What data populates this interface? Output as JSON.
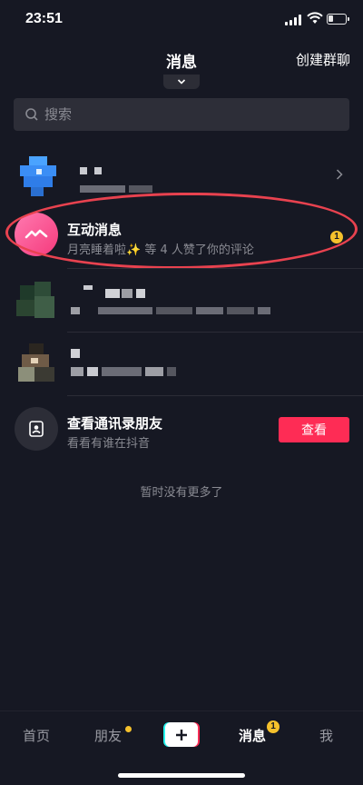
{
  "status_bar": {
    "time": "23:51"
  },
  "header": {
    "title": "消息",
    "create_group": "创建群聊"
  },
  "search": {
    "placeholder": "搜索"
  },
  "interaction": {
    "title": "互动消息",
    "subtitle": "月亮睡着啦✨ 等 4 人赞了你的评论",
    "badge": "1"
  },
  "contacts_prompt": {
    "title": "查看通讯录朋友",
    "subtitle": "看看有谁在抖音",
    "button": "查看"
  },
  "no_more": "暂时没有更多了",
  "tabbar": {
    "home": "首页",
    "friends": "朋友",
    "messages": "消息",
    "messages_badge": "1",
    "me": "我"
  },
  "colors": {
    "accent": "#fe2c55",
    "badge": "#f5c12c",
    "background": "#161823"
  }
}
